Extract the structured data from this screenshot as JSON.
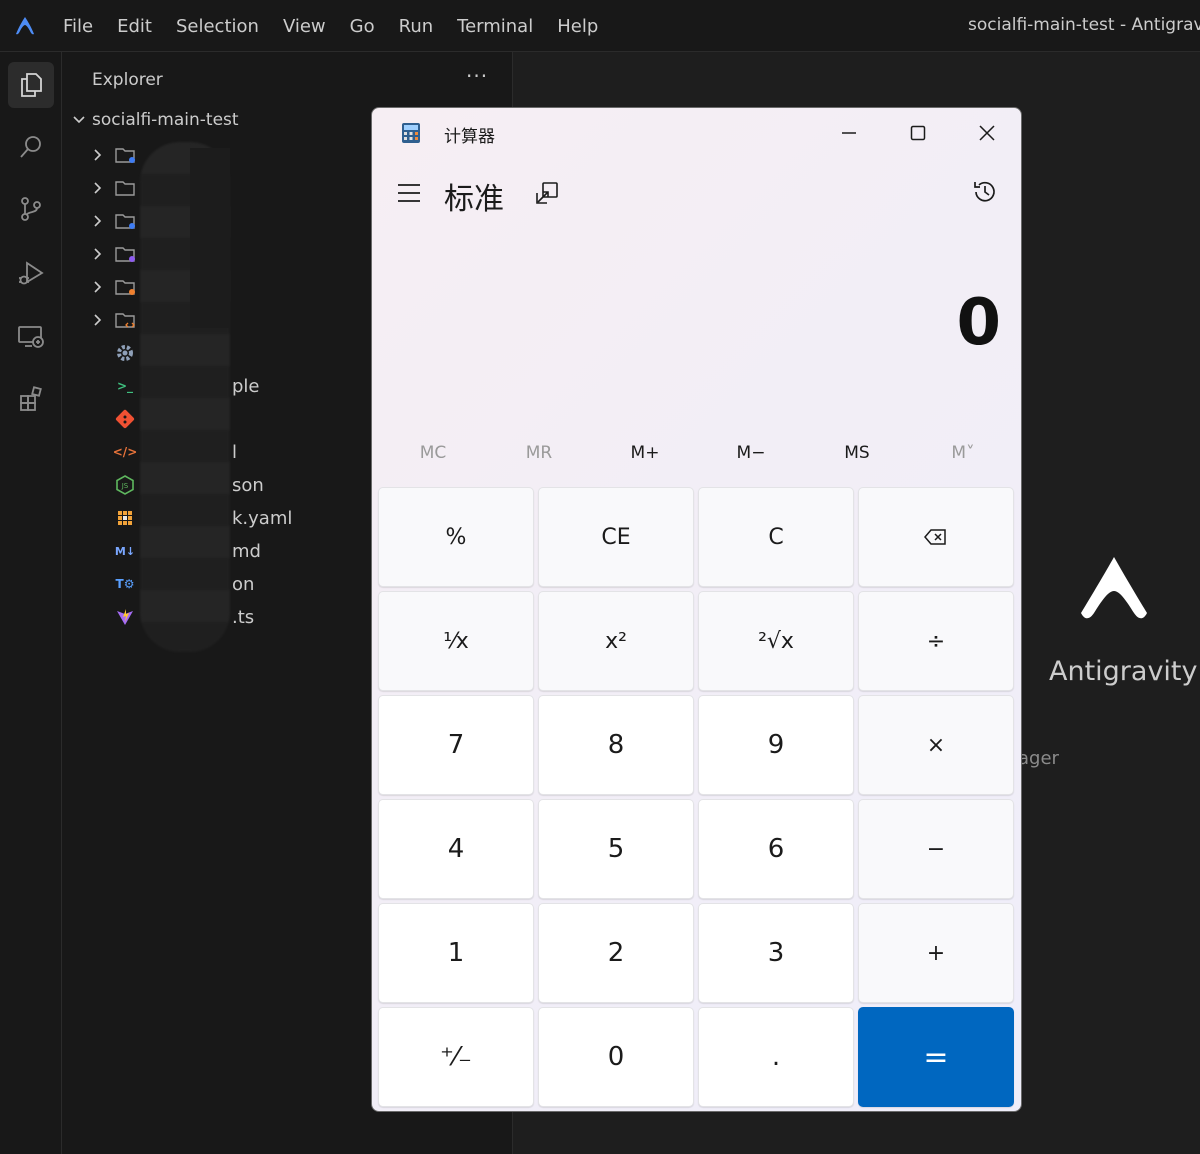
{
  "menubar": {
    "items": [
      "File",
      "Edit",
      "Selection",
      "View",
      "Go",
      "Run",
      "Terminal",
      "Help"
    ],
    "window_title": "socialfi-main-test - Antigravit"
  },
  "activitybar": {
    "icons": [
      "explorer-icon",
      "search-icon",
      "source-control-icon",
      "run-debug-icon",
      "remote-explorer-icon",
      "extensions-icon"
    ]
  },
  "explorer": {
    "title": "Explorer",
    "more": "···",
    "root_folder": "socialfi-main-test",
    "visible_fragments": [
      "ple",
      "l",
      "son",
      "k.yaml",
      "md",
      "on",
      ".ts"
    ]
  },
  "calculator": {
    "app_title": "计算器",
    "mode_title": "标准",
    "display_value": "0",
    "memory": [
      "MC",
      "MR",
      "M+",
      "M−",
      "MS",
      "M˅"
    ],
    "keys": [
      [
        "%",
        "CE",
        "C",
        "⌫"
      ],
      [
        "¹⁄x",
        "x²",
        "²√x",
        "÷"
      ],
      [
        "7",
        "8",
        "9",
        "×"
      ],
      [
        "4",
        "5",
        "6",
        "−"
      ],
      [
        "1",
        "2",
        "3",
        "+"
      ],
      [
        "⁺⁄₋",
        "0",
        ".",
        "="
      ]
    ]
  },
  "welcome": {
    "product_name": "Antigravity",
    "hint_fragment": "ager"
  },
  "colors": {
    "accent_blue": "#0067c0",
    "editor_bg": "#181818",
    "menu_text": "#cccccc"
  }
}
